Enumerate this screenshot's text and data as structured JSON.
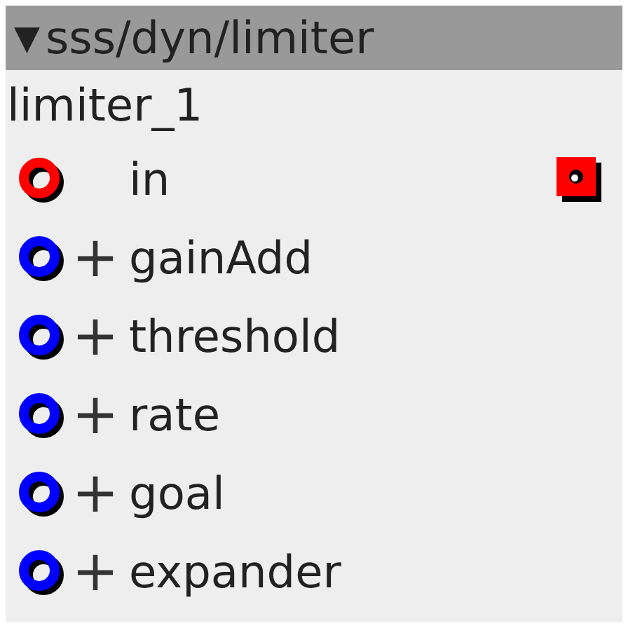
{
  "header": {
    "arrow": "▼",
    "title": "sss/dyn/limiter"
  },
  "instance": "limiter_1",
  "ports": [
    {
      "label": "in",
      "color": "#ff0000",
      "outlet": true
    },
    {
      "label": "gainAdd",
      "color": "#0000ff",
      "plus": "+",
      "outlet": false
    },
    {
      "label": "threshold",
      "color": "#0000ff",
      "plus": "+",
      "outlet": false
    },
    {
      "label": "rate",
      "color": "#0000ff",
      "plus": "+",
      "outlet": false
    },
    {
      "label": "goal",
      "color": "#0000ff",
      "plus": "+",
      "outlet": false
    },
    {
      "label": "expander",
      "color": "#0000ff",
      "plus": "+",
      "outlet": false
    }
  ]
}
